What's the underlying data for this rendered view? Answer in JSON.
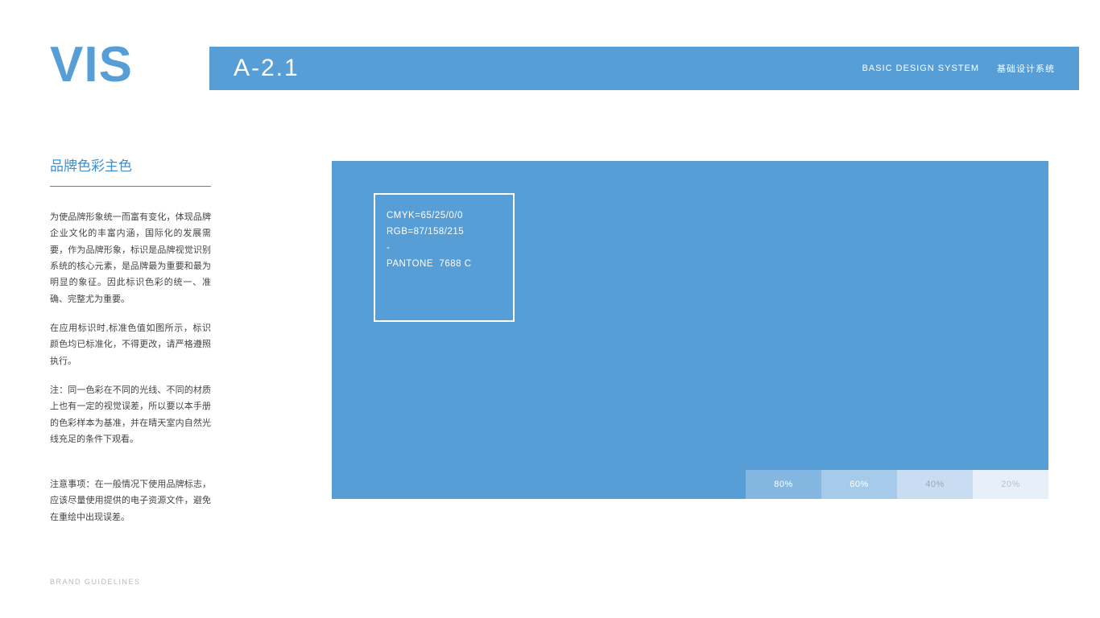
{
  "colors": {
    "brand_blue": "#579ed7"
  },
  "header": {
    "vis": "VIS",
    "page_code": "A-2.1",
    "en": "BASIC DESIGN SYSTEM",
    "cn": "基础设计系统"
  },
  "left": {
    "title": "品牌色彩主色",
    "p1": "为使品牌形象统一而富有变化，体现品牌企业文化的丰富内涵，国际化的发展需要，作为品牌形象，标识是品牌视觉识别系统的核心元素，是品牌最为重要和最为明显的象征。因此标识色彩的统一、准确、完整尤为重要。",
    "p2": "在应用标识时,标准色值如图所示，标识颜色均已标准化，不得更改，请严格遵照执行。",
    "p3": "注：同一色彩在不同的光线、不同的材质上也有一定的视觉误差，所以要以本手册的色彩样本为基准，并在晴天室内自然光线充足的条件下观看。",
    "note": "注意事项：在一般情况下使用品牌标志，应该尽量使用提供的电子资源文件，避免在重绘中出现误差。"
  },
  "swatch": {
    "l1": "CMYK=65/25/0/0",
    "l2": "RGB=87/158/215",
    "l3": "-",
    "l4": "PANTONE  7688 C"
  },
  "tints": {
    "t80": "80%",
    "t60": "60%",
    "t40": "40%",
    "t20": "20%"
  },
  "footer": {
    "brand": "BRAND GUIDELINES"
  }
}
